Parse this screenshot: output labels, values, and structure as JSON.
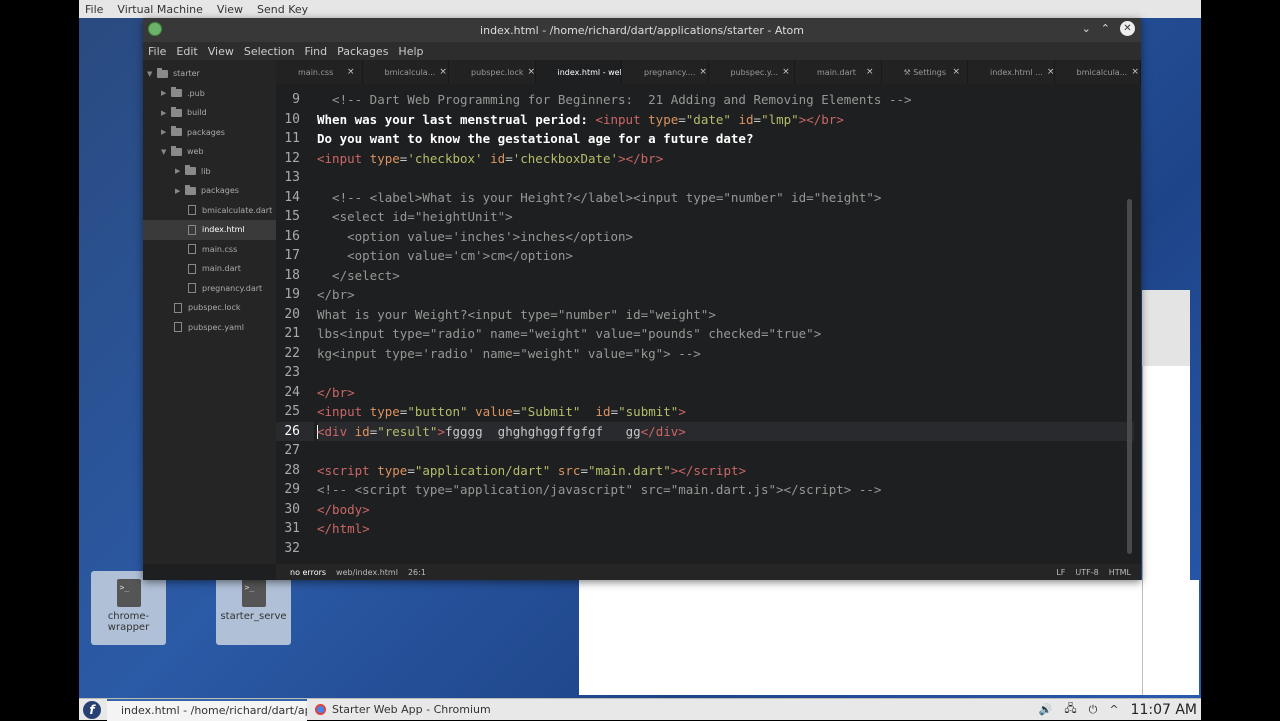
{
  "vm_menu": [
    "File",
    "Virtual Machine",
    "View",
    "Send Key"
  ],
  "atom": {
    "title": "index.html - /home/richard/dart/applications/starter - Atom",
    "menu": [
      "File",
      "Edit",
      "View",
      "Selection",
      "Find",
      "Packages",
      "Help"
    ],
    "tree": [
      {
        "label": "starter",
        "kind": "folder-open",
        "depth": 0
      },
      {
        "label": ".pub",
        "kind": "folder",
        "depth": 1
      },
      {
        "label": "build",
        "kind": "folder",
        "depth": 1
      },
      {
        "label": "packages",
        "kind": "folder",
        "depth": 1
      },
      {
        "label": "web",
        "kind": "folder-open",
        "depth": 1
      },
      {
        "label": "lib",
        "kind": "folder",
        "depth": 2
      },
      {
        "label": "packages",
        "kind": "folder",
        "depth": 2
      },
      {
        "label": "bmicalculate.dart",
        "kind": "file",
        "depth": 2
      },
      {
        "label": "index.html",
        "kind": "file",
        "depth": 2,
        "selected": true
      },
      {
        "label": "main.css",
        "kind": "file",
        "depth": 2
      },
      {
        "label": "main.dart",
        "kind": "file",
        "depth": 2
      },
      {
        "label": "pregnancy.dart",
        "kind": "file",
        "depth": 2
      },
      {
        "label": "pubspec.lock",
        "kind": "file",
        "depth": 1
      },
      {
        "label": "pubspec.yaml",
        "kind": "file",
        "depth": 1
      }
    ],
    "tabs": [
      {
        "label": "main.css"
      },
      {
        "label": "bmicalcula..."
      },
      {
        "label": "pubspec.lock"
      },
      {
        "label": "index.html - web",
        "active": true
      },
      {
        "label": "pregnancy...."
      },
      {
        "label": "pubspec.y..."
      },
      {
        "label": "main.dart"
      },
      {
        "label": "Settings",
        "icon": "settings-icon"
      },
      {
        "label": "index.html ..."
      },
      {
        "label": "bmicalcula..."
      }
    ],
    "line_numbers": [
      "9",
      "10",
      "11",
      "12",
      "13",
      "14",
      "15",
      "16",
      "17",
      "18",
      "19",
      "20",
      "21",
      "22",
      "23",
      "24",
      "25",
      "26",
      "27",
      "28",
      "29",
      "30",
      "31",
      "32"
    ],
    "current_line": "26",
    "status": {
      "errors": "no errors",
      "path": "web/index.html",
      "cursor": "26:1",
      "eol": "LF",
      "encoding": "UTF-8",
      "grammar": "HTML"
    }
  },
  "desktop_icons": [
    {
      "label": "chrome-wrapper"
    },
    {
      "label": "starter_serve"
    }
  ],
  "taskbar": {
    "fedora_glyph": "f",
    "tasks": [
      {
        "label": "index.html - /home/richard/dart/applications/starter - Atom",
        "active": true
      },
      {
        "label": "Starter Web App - Chromium"
      }
    ],
    "tray": {
      "volume": "🔊",
      "network": "🖧",
      "power": "⏻",
      "arrow": "^",
      "time": "11:07 AM"
    }
  }
}
